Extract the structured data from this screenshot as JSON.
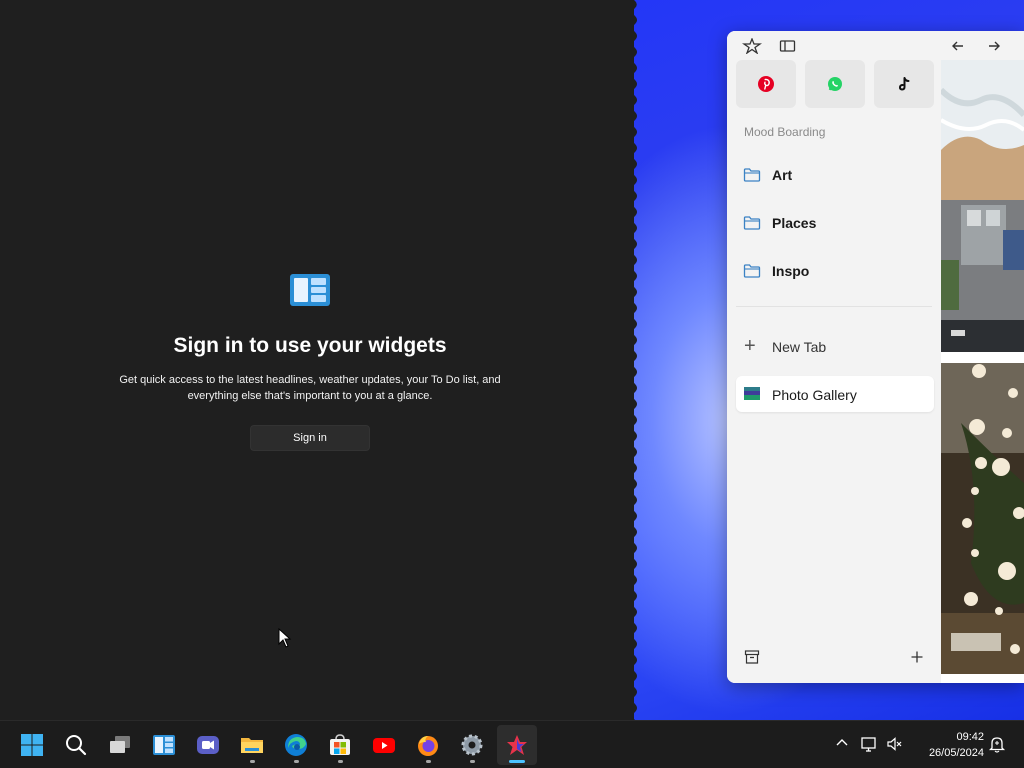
{
  "widgets": {
    "title": "Sign in to use your widgets",
    "description_line1": "Get quick access to the latest headlines, weather updates, your To Do list, and",
    "description_line2": "everything else that's important to you at a glance.",
    "signin_label": "Sign in"
  },
  "browser": {
    "toolbar_icons": [
      "app-logo-icon",
      "sidebar-toggle-icon",
      "back-arrow-icon",
      "forward-arrow-icon"
    ],
    "pinned_sites": [
      {
        "name": "pinterest-icon",
        "color": "#e60023"
      },
      {
        "name": "whatsapp-icon",
        "color": "#25d366"
      },
      {
        "name": "tiktok-icon",
        "color": "#000000"
      }
    ],
    "section_label": "Mood Boarding",
    "folders": [
      {
        "label": "Art"
      },
      {
        "label": "Places"
      },
      {
        "label": "Inspo"
      }
    ],
    "new_tab_label": "New Tab",
    "active_tab_label": "Photo Gallery",
    "bottom_icons": [
      "archive-icon",
      "add-icon"
    ]
  },
  "taskbar": {
    "apps": [
      "start-icon",
      "search-icon",
      "task-view-icon",
      "widgets-icon",
      "teams-icon",
      "file-explorer-icon",
      "edge-icon",
      "store-icon",
      "youtube-icon",
      "firefox-icon",
      "settings-icon",
      "browser-app-icon"
    ],
    "time": "09:42",
    "date": "26/05/2024",
    "accent_color": "#4cc2ff"
  }
}
